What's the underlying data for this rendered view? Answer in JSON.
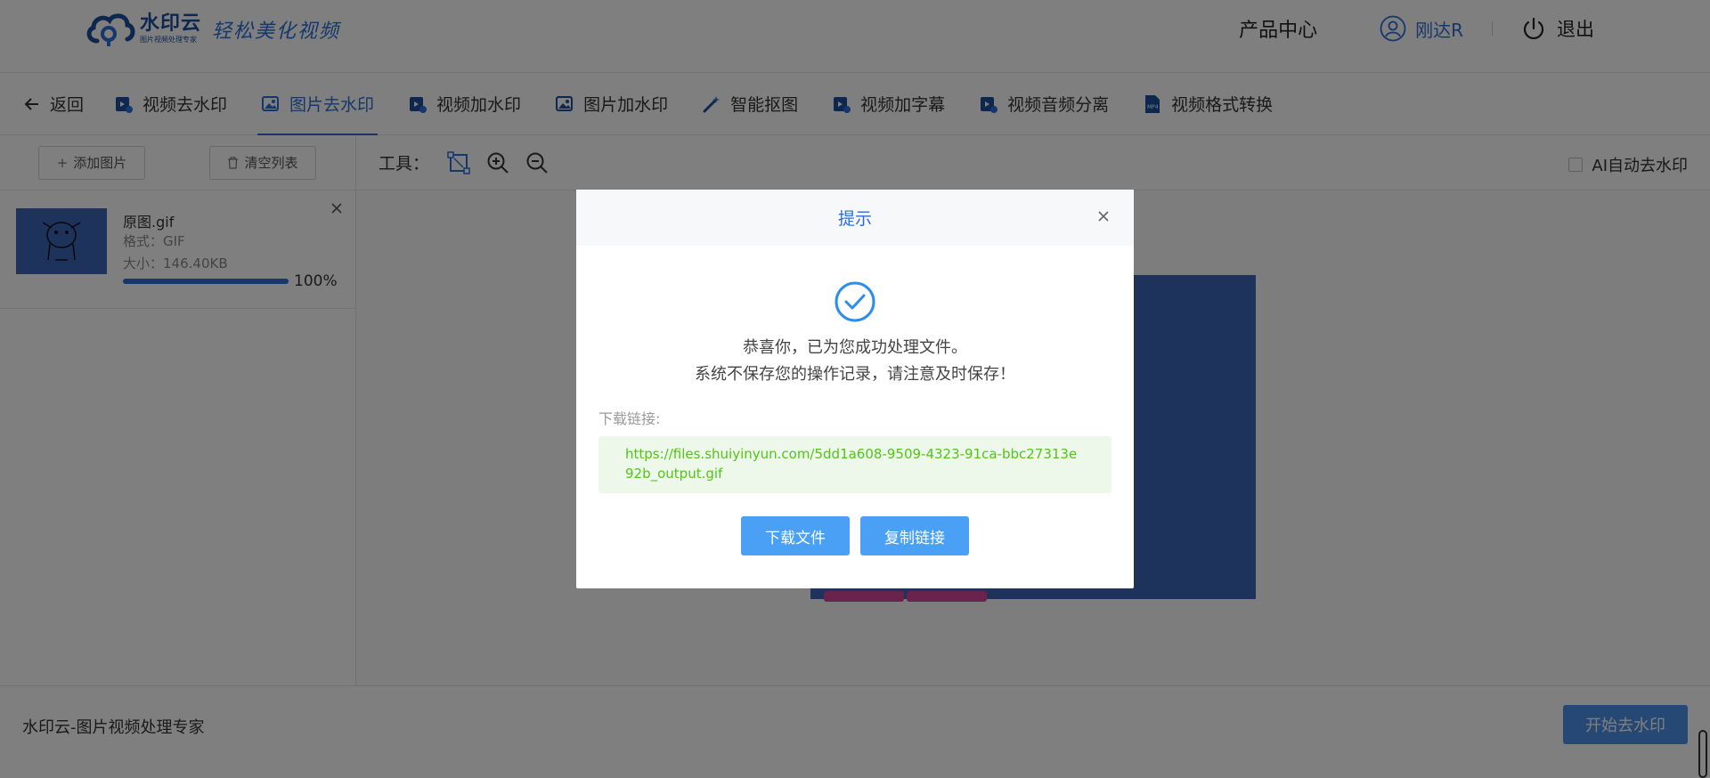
{
  "header": {
    "logo_name": "水印云",
    "logo_sub": "图片视频处理专家",
    "logo_slogan": "轻松美化视频",
    "product_center": "产品中心",
    "username": "刚达R",
    "logout": "退出"
  },
  "nav": {
    "back": "返回",
    "items": [
      {
        "label": "视频去水印",
        "icon": "video-icon"
      },
      {
        "label": "图片去水印",
        "icon": "image-icon",
        "active": true
      },
      {
        "label": "视频加水印",
        "icon": "video-icon"
      },
      {
        "label": "图片加水印",
        "icon": "image-icon"
      },
      {
        "label": "智能抠图",
        "icon": "magic-wand-icon"
      },
      {
        "label": "视频加字幕",
        "icon": "video-icon"
      },
      {
        "label": "视频音频分离",
        "icon": "video-icon"
      },
      {
        "label": "视频格式转换",
        "icon": "mp4-file-icon"
      }
    ]
  },
  "sidebar": {
    "add_image": "添加图片",
    "clear_list": "清空列表",
    "file": {
      "name": "原图.gif",
      "format": "格式：GIF",
      "size": "大小：146.40KB",
      "progress": 1.0,
      "progress_text": "100%"
    }
  },
  "workspace": {
    "tools_label": "工具：",
    "ai_auto": "AI自动去水印"
  },
  "footer": {
    "brand": "水印云-图片视频处理专家",
    "start_button": "开始去水印"
  },
  "modal": {
    "title": "提示",
    "message_line1": "恭喜你，已为您成功处理文件。",
    "message_line2": "系统不保存您的操作记录，请注意及时保存！",
    "download_label": "下载链接:",
    "download_url": "https://files.shuiyinyun.com/5dd1a608-9509-4323-91ca-bbc27313e92b_output.gif",
    "download_button": "下载文件",
    "copy_button": "复制链接"
  },
  "colors": {
    "accent": "#2a6fd8",
    "button_blue": "#4aa0f5",
    "link_green": "#52c41a",
    "image_blue": "#3d66b8"
  }
}
